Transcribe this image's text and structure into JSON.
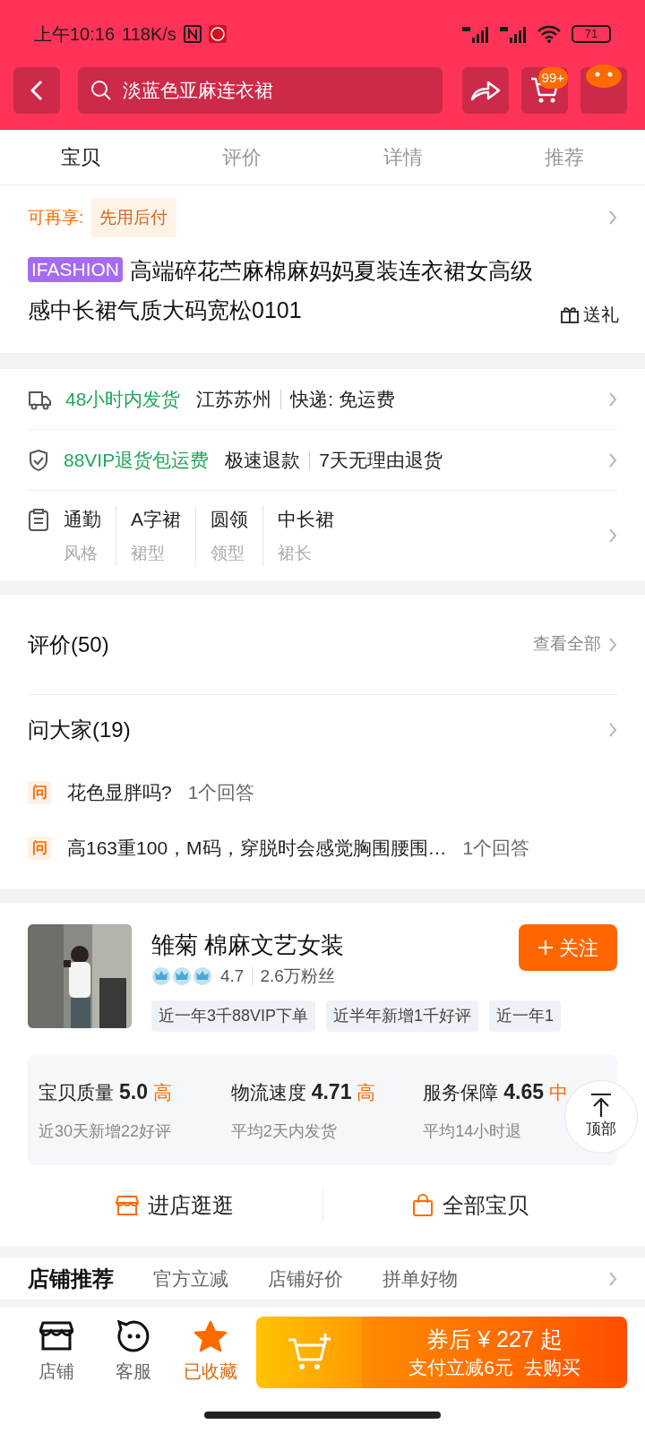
{
  "status_bar": {
    "time": "上午10:16",
    "speed": "118K/s",
    "battery": "71"
  },
  "search": {
    "value": "淡蓝色亚麻连衣裙"
  },
  "cart_badge": "99+",
  "tabs": [
    {
      "label": "宝贝",
      "selected": true
    },
    {
      "label": "评价",
      "selected": false
    },
    {
      "label": "详情",
      "selected": false
    },
    {
      "label": "推荐",
      "selected": false
    }
  ],
  "pay_later": {
    "label": "可再享:",
    "tag": "先用后付"
  },
  "product": {
    "brand": "IFASHION",
    "title": "高端碎花苎麻棉麻妈妈夏装连衣裙女高级感中长裙气质大码宽松0101",
    "gift": "送礼"
  },
  "services": [
    {
      "kind": "shipping",
      "highlight": "48小时内发货",
      "parts": [
        "江苏苏州",
        "快递: 免运费"
      ]
    },
    {
      "kind": "guarantee",
      "highlight": "88VIP退货包运费",
      "parts": [
        "极速退款",
        "7天无理由退货"
      ]
    }
  ],
  "attributes": [
    {
      "value": "通勤",
      "name": "风格"
    },
    {
      "value": "A字裙",
      "name": "裙型"
    },
    {
      "value": "圆领",
      "name": "领型"
    },
    {
      "value": "中长裙",
      "name": "裙长"
    }
  ],
  "reviews": {
    "title": "评价(50)",
    "see_all": "查看全部"
  },
  "questions": {
    "title": "问大家(19)",
    "items": [
      {
        "badge": "问",
        "question": "花色显胖吗?",
        "answers": "1个回答"
      },
      {
        "badge": "问",
        "question": "高163重100，M码，穿脱时会感觉胸围腰围…",
        "answers": "1个回答"
      }
    ]
  },
  "store": {
    "name": "雏菊 棉麻文艺女装",
    "rating": "4.7",
    "fans": "2.6万粉丝",
    "follow": "关注",
    "tags": [
      "近一年3千88VIP下单",
      "近半年新增1千好评",
      "近一年1"
    ],
    "scores": [
      {
        "label": "宝贝质量",
        "score": "5.0",
        "grade": "高",
        "note": "近30天新增22好评"
      },
      {
        "label": "物流速度",
        "score": "4.71",
        "grade": "高",
        "note": "平均2天内发货"
      },
      {
        "label": "服务保障",
        "score": "4.65",
        "grade": "中",
        "note": "平均14小时退"
      }
    ],
    "actions": [
      {
        "kind": "shop",
        "label": "进店逛逛"
      },
      {
        "kind": "bag",
        "label": "全部宝贝"
      }
    ]
  },
  "back_to_top": "顶部",
  "recommend_tabs": [
    {
      "label": "店铺推荐",
      "selected": true
    },
    {
      "label": "官方立减",
      "selected": false
    },
    {
      "label": "店铺好价",
      "selected": false
    },
    {
      "label": "拼单好物",
      "selected": false
    }
  ],
  "bottom_bar": {
    "items": [
      {
        "kind": "store",
        "label": "店铺",
        "selected": false
      },
      {
        "kind": "service",
        "label": "客服",
        "selected": false
      },
      {
        "kind": "favorite",
        "label": "已收藏",
        "selected": true
      }
    ],
    "price": "券后 ¥ 227 起",
    "promo": "支付立减6元  去购买"
  }
}
